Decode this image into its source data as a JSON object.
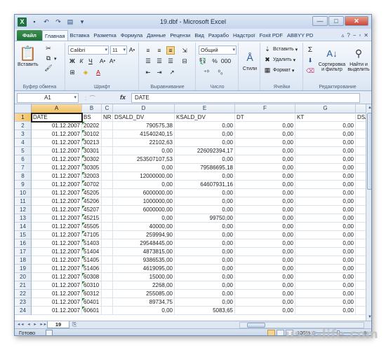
{
  "app": {
    "title": "19.dbf  -  Microsoft Excel",
    "logo_letter": "X",
    "quick_access": [
      "save-icon",
      "undo-icon",
      "redo-icon",
      "toolbar-icon",
      "customize-icon"
    ]
  },
  "tabs": [
    {
      "label": "Файл",
      "kind": "file"
    },
    {
      "label": "Главная",
      "kind": "active"
    },
    {
      "label": "Вставка"
    },
    {
      "label": "Разметка"
    },
    {
      "label": "Формула"
    },
    {
      "label": "Данные"
    },
    {
      "label": "Рецензи"
    },
    {
      "label": "Вид"
    },
    {
      "label": "Разрабо"
    },
    {
      "label": "Надстрої"
    },
    {
      "label": "Foxit PDF"
    },
    {
      "label": "ABBYY PD"
    }
  ],
  "ribbon": {
    "clipboard": {
      "paste_label": "Вставить",
      "group_label": "Буфер обмена"
    },
    "font": {
      "name": "Calibri",
      "size": "11",
      "group_label": "Шрифт"
    },
    "alignment": {
      "group_label": "Выравнивание"
    },
    "number": {
      "format": "Общий",
      "group_label": "Число"
    },
    "styles": {
      "label": "Стили"
    },
    "cells": {
      "insert": "Вставить",
      "delete": "Удалить",
      "format": "Формат",
      "group_label": "Ячейки"
    },
    "editing": {
      "sort_line1": "Сортировка",
      "sort_line2": "и фильтр",
      "find_line1": "Найти и",
      "find_line2": "выделить",
      "group_label": "Редактирование"
    }
  },
  "formula_bar": {
    "name_box": "A1",
    "fx": "fx",
    "content": "DATE"
  },
  "columns": [
    {
      "letter": "A",
      "selected": true
    },
    {
      "letter": "B"
    },
    {
      "letter": "C"
    },
    {
      "letter": "D"
    },
    {
      "letter": "E"
    },
    {
      "letter": "F"
    },
    {
      "letter": "G"
    },
    {
      "letter": ""
    }
  ],
  "header_row": [
    "DATE",
    "BS",
    "NR",
    "DSALD_DV",
    "KSALD_DV",
    "DT",
    "KT",
    "DSALD_"
  ],
  "rows": [
    {
      "n": "2",
      "date": "01.12.2007",
      "bs": "20202",
      "dsald": "790575,38",
      "ksald": "0,00",
      "dt": "0,00",
      "kt": "0,00"
    },
    {
      "n": "3",
      "date": "01.12.2007",
      "bs": "30102",
      "dsald": "41540240,15",
      "ksald": "0,00",
      "dt": "0,00",
      "kt": "0,00"
    },
    {
      "n": "4",
      "date": "01.12.2007",
      "bs": "30213",
      "dsald": "22102,63",
      "ksald": "0,00",
      "dt": "0,00",
      "kt": "0,00"
    },
    {
      "n": "5",
      "date": "01.12.2007",
      "bs": "30301",
      "dsald": "0,00",
      "ksald": "226092394,17",
      "dt": "0,00",
      "kt": "0,00"
    },
    {
      "n": "6",
      "date": "01.12.2007",
      "bs": "30302",
      "dsald": "253507107,53",
      "ksald": "0,00",
      "dt": "0,00",
      "kt": "0,00"
    },
    {
      "n": "7",
      "date": "01.12.2007",
      "bs": "30305",
      "dsald": "0,00",
      "ksald": "79586695,18",
      "dt": "0,00",
      "kt": "0,00"
    },
    {
      "n": "8",
      "date": "01.12.2007",
      "bs": "32003",
      "dsald": "12000000,00",
      "ksald": "0,00",
      "dt": "0,00",
      "kt": "0,00"
    },
    {
      "n": "9",
      "date": "01.12.2007",
      "bs": "40702",
      "dsald": "0,00",
      "ksald": "64607931,16",
      "dt": "0,00",
      "kt": "0,00"
    },
    {
      "n": "10",
      "date": "01.12.2007",
      "bs": "45205",
      "dsald": "6000000,00",
      "ksald": "0,00",
      "dt": "0,00",
      "kt": "0,00"
    },
    {
      "n": "11",
      "date": "01.12.2007",
      "bs": "45206",
      "dsald": "1000000,00",
      "ksald": "0,00",
      "dt": "0,00",
      "kt": "0,00"
    },
    {
      "n": "12",
      "date": "01.12.2007",
      "bs": "45207",
      "dsald": "6000000,00",
      "ksald": "0,00",
      "dt": "0,00",
      "kt": "0,00"
    },
    {
      "n": "13",
      "date": "01.12.2007",
      "bs": "45215",
      "dsald": "0,00",
      "ksald": "99750,00",
      "dt": "0,00",
      "kt": "0,00"
    },
    {
      "n": "14",
      "date": "01.12.2007",
      "bs": "45505",
      "dsald": "40000,00",
      "ksald": "0,00",
      "dt": "0,00",
      "kt": "0,00"
    },
    {
      "n": "15",
      "date": "01.12.2007",
      "bs": "47105",
      "dsald": "259994,90",
      "ksald": "0,00",
      "dt": "0,00",
      "kt": "0,00"
    },
    {
      "n": "16",
      "date": "01.12.2007",
      "bs": "51403",
      "dsald": "29548445,00",
      "ksald": "0,00",
      "dt": "0,00",
      "kt": "0,00"
    },
    {
      "n": "17",
      "date": "01.12.2007",
      "bs": "51404",
      "dsald": "4873815,00",
      "ksald": "0,00",
      "dt": "0,00",
      "kt": "0,00"
    },
    {
      "n": "18",
      "date": "01.12.2007",
      "bs": "51405",
      "dsald": "9386535,00",
      "ksald": "0,00",
      "dt": "0,00",
      "kt": "0,00"
    },
    {
      "n": "19",
      "date": "01.12.2007",
      "bs": "51406",
      "dsald": "4619095,00",
      "ksald": "0,00",
      "dt": "0,00",
      "kt": "0,00"
    },
    {
      "n": "20",
      "date": "01.12.2007",
      "bs": "60308",
      "dsald": "15000,00",
      "ksald": "0,00",
      "dt": "0,00",
      "kt": "0,00"
    },
    {
      "n": "21",
      "date": "01.12.2007",
      "bs": "60310",
      "dsald": "2268,00",
      "ksald": "0,00",
      "dt": "0,00",
      "kt": "0,00"
    },
    {
      "n": "22",
      "date": "01.12.2007",
      "bs": "60312",
      "dsald": "255085,00",
      "ksald": "0,00",
      "dt": "0,00",
      "kt": "0,00"
    },
    {
      "n": "23",
      "date": "01.12.2007",
      "bs": "60401",
      "dsald": "89734,75",
      "ksald": "0,00",
      "dt": "0,00",
      "kt": "0,00"
    },
    {
      "n": "24",
      "date": "01.12.2007",
      "bs": "60601",
      "dsald": "0,00",
      "ksald": "5083,65",
      "dt": "0,00",
      "kt": "0,00"
    }
  ],
  "sheet_tab": "19",
  "status": {
    "ready": "Готово",
    "zoom": "100%",
    "zoom_fraction": 0.5
  },
  "watermark": "user-life.com"
}
